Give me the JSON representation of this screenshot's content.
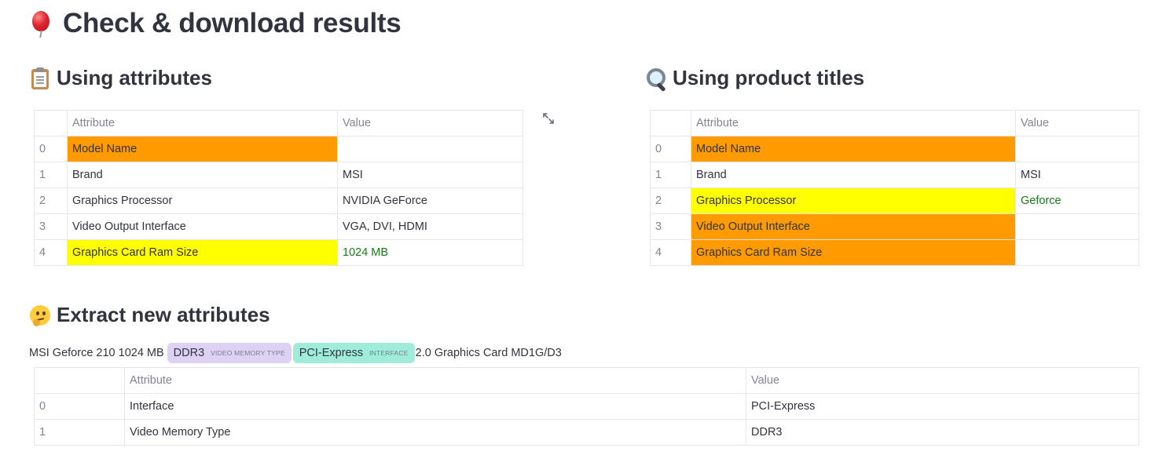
{
  "header": {
    "title": "Check & download results",
    "icon": "balloon-icon"
  },
  "attributes_section": {
    "title": "Using attributes",
    "icon": "clipboard-icon",
    "columns": [
      "",
      "Attribute",
      "Value"
    ],
    "rows": [
      {
        "index": "0",
        "attribute": "Model Name",
        "value": "",
        "highlight": "orange"
      },
      {
        "index": "1",
        "attribute": "Brand",
        "value": "MSI",
        "highlight": "none"
      },
      {
        "index": "2",
        "attribute": "Graphics Processor",
        "value": "NVIDIA GeForce",
        "highlight": "none"
      },
      {
        "index": "3",
        "attribute": "Video Output Interface",
        "value": "VGA, DVI, HDMI",
        "highlight": "none"
      },
      {
        "index": "4",
        "attribute": "Graphics Card Ram Size",
        "value": "1024 MB",
        "highlight": "yellow"
      }
    ]
  },
  "titles_section": {
    "title": "Using product titles",
    "icon": "magnifier-icon",
    "columns": [
      "",
      "Attribute",
      "Value"
    ],
    "rows": [
      {
        "index": "0",
        "attribute": "Model Name",
        "value": "",
        "highlight": "orange"
      },
      {
        "index": "1",
        "attribute": "Brand",
        "value": "MSI",
        "highlight": "none"
      },
      {
        "index": "2",
        "attribute": "Graphics Processor",
        "value": "Geforce",
        "highlight": "yellow"
      },
      {
        "index": "3",
        "attribute": "Video Output Interface",
        "value": "",
        "highlight": "orange"
      },
      {
        "index": "4",
        "attribute": "Graphics Card Ram Size",
        "value": "",
        "highlight": "orange"
      }
    ]
  },
  "extract_section": {
    "title": "Extract new attributes",
    "icon": "thinking-face-icon",
    "text_before": "MSI Geforce 210 1024 MB",
    "entity1": {
      "text": "DDR3",
      "label": "VIDEO MEMORY TYPE",
      "color": "#ddd1f4"
    },
    "entity2": {
      "text": "PCI-Express",
      "label": "INTERFACE",
      "color": "#9eecd9"
    },
    "text_after": "2.0 Graphics Card MD1G/D3",
    "columns": [
      "",
      "Attribute",
      "Value"
    ],
    "rows": [
      {
        "index": "0",
        "attribute": "Interface",
        "value": "PCI-Express"
      },
      {
        "index": "1",
        "attribute": "Video Memory Type",
        "value": "DDR3"
      }
    ]
  },
  "colors": {
    "orange": "#ff9b00",
    "yellow": "#ffff00",
    "match_text": "#1a7a1a"
  },
  "expand_icon": "expand-icon"
}
